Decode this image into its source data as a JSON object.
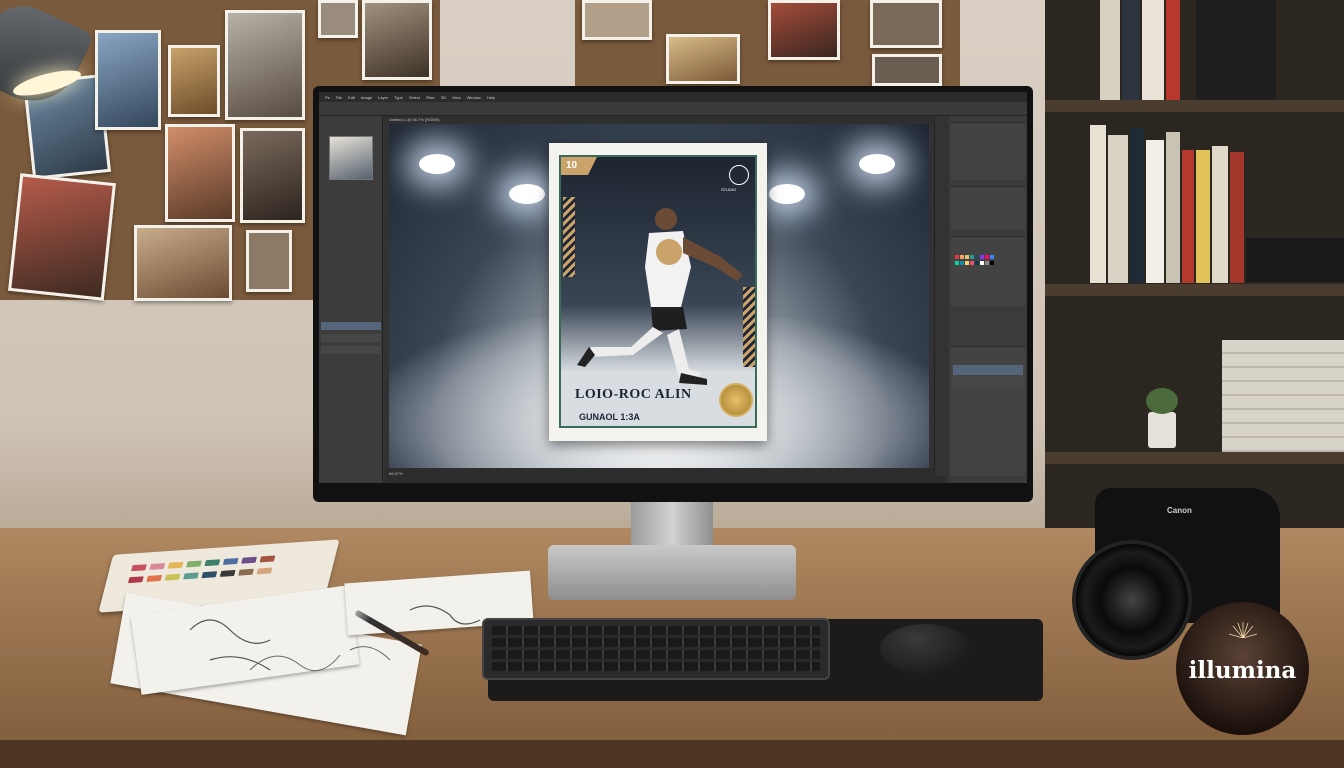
{
  "scene": {
    "description_items": [
      "corkboard",
      "monitor",
      "desk",
      "camera",
      "watermark"
    ]
  },
  "screen": {
    "menu_items": [
      "Ps",
      "File",
      "Edit",
      "Image",
      "Layer",
      "Type",
      "Select",
      "Filter",
      "3D",
      "View",
      "Window",
      "Help"
    ],
    "doc_tab": "Untitled-1 @ 66.7% (RGB/8)",
    "status": "66.67%"
  },
  "card": {
    "badge": "10",
    "logo_text": "STUDIO",
    "player_name": "LOIO-ROC ALIN",
    "subtitle": "GUNAOL 1:3A"
  },
  "camera": {
    "brand": "Canon"
  },
  "watermark": {
    "text": "illumina"
  },
  "colors": {
    "accent_teal": "#3a6b5a",
    "gold": "#c9a36a",
    "navy": "#1d2535"
  }
}
